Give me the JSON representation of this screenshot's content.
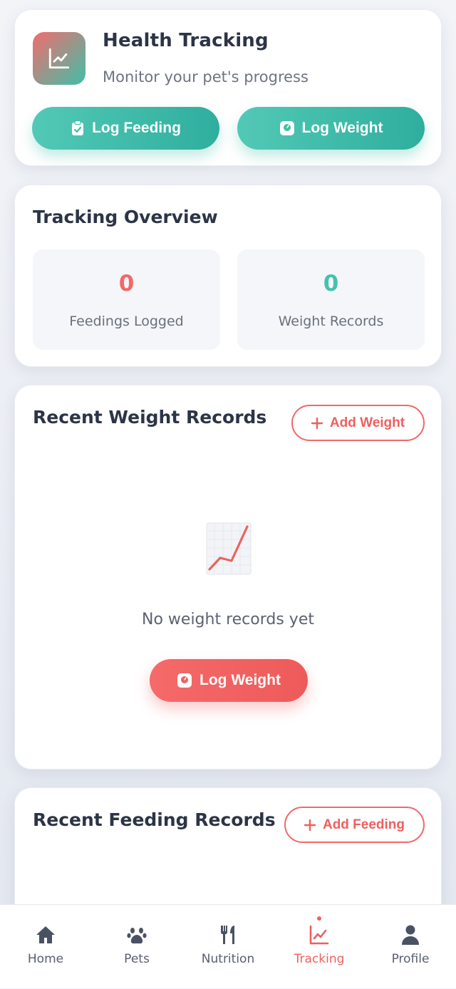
{
  "header": {
    "title": "Health Tracking",
    "subtitle": "Monitor your pet's progress",
    "log_feeding_label": "Log Feeding",
    "log_weight_label": "Log Weight",
    "logo_icon": "chart-line-icon"
  },
  "overview": {
    "title": "Tracking Overview",
    "stats": [
      {
        "value": "0",
        "label": "Feedings Logged",
        "color": "#f26868"
      },
      {
        "value": "0",
        "label": "Weight Records",
        "color": "#45c2ad"
      }
    ]
  },
  "weight_records": {
    "title": "Recent Weight Records",
    "add_label": "Add Weight",
    "empty_text": "No weight records yet",
    "log_label": "Log Weight",
    "empty_icon": "chart-increasing-emoji"
  },
  "feeding_records": {
    "title": "Recent Feeding Records",
    "add_label": "Add Feeding"
  },
  "nav": {
    "items": [
      {
        "label": "Home",
        "icon": "home-icon"
      },
      {
        "label": "Pets",
        "icon": "paw-icon"
      },
      {
        "label": "Nutrition",
        "icon": "utensils-icon"
      },
      {
        "label": "Tracking",
        "icon": "chart-line-icon"
      },
      {
        "label": "Profile",
        "icon": "user-icon"
      }
    ],
    "active": "Tracking"
  },
  "colors": {
    "accent_coral": "#f05f5f",
    "accent_teal": "#3fbfa8",
    "text_dark": "#2c3446",
    "text_muted": "#6e7480"
  }
}
